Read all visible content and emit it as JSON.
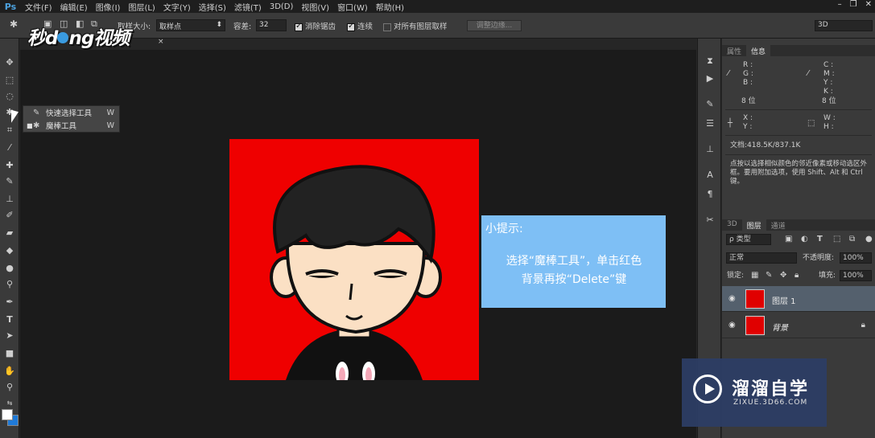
{
  "app": {
    "logo": "Ps"
  },
  "menu": [
    "文件(F)",
    "编辑(E)",
    "图像(I)",
    "图层(L)",
    "文字(Y)",
    "选择(S)",
    "滤镜(T)",
    "3D(D)",
    "视图(V)",
    "窗口(W)",
    "帮助(H)"
  ],
  "window_controls": [
    "–",
    "❐",
    "✕"
  ],
  "options": {
    "sample_size_label": "取样大小:",
    "sample_size_value": "取样点",
    "tolerance_label": "容差:",
    "tolerance_value": "32",
    "antialias_label": "消除锯齿",
    "antialias_checked": true,
    "contiguous_label": "连续",
    "contiguous_checked": true,
    "all_layers_label": "对所有图层取样",
    "all_layers_checked": false,
    "refine_edge_label": "调整边缘...",
    "workspace_value": "3D"
  },
  "watermark_logo": {
    "part1": "秒",
    "part2": "d",
    "part3": "ng视频"
  },
  "document_tab": {
    "close": "×"
  },
  "flyout": {
    "items": [
      {
        "label": "快速选择工具",
        "key": "W",
        "icon": "quick-select-icon",
        "active": false
      },
      {
        "label": "魔棒工具",
        "key": "W",
        "icon": "magic-wand-icon",
        "active": true
      }
    ]
  },
  "tip": {
    "title": "小提示:",
    "line1": "选择“魔棒工具”，单击红色",
    "line2": "背景再按“Delete”键"
  },
  "panels": {
    "top_tabs": [
      "属性",
      "信息"
    ],
    "info": {
      "rgb_labels": [
        "R :",
        "G :",
        "B :"
      ],
      "cmyk_labels": [
        "C :",
        "M :",
        "Y :",
        "K :"
      ],
      "bit_left": "8 位",
      "bit_right": "8 位",
      "xy_labels": [
        "X :",
        "Y :"
      ],
      "wh_labels": [
        "W :",
        "H :"
      ],
      "doc_size": "文档:418.5K/837.1K",
      "hint": "点按以选择相似颜色的邻近像素或移动选区外框。要用附加选项，使用 Shift、Alt 和 Ctrl 键。"
    },
    "layer_tabs": [
      "3D",
      "图层",
      "通道"
    ],
    "filter_kind": "ρ 类型",
    "blend_mode": "正常",
    "opacity_label": "不透明度:",
    "opacity_value": "100%",
    "lock_label": "锁定:",
    "fill_label": "填充:",
    "fill_value": "100%",
    "layers": [
      {
        "name": "图层 1",
        "selected": true,
        "locked": false
      },
      {
        "name": "背景",
        "selected": false,
        "locked": true
      }
    ]
  },
  "brand": {
    "name": "溜溜自学",
    "url": "ZIXUE.3D66.COM"
  }
}
